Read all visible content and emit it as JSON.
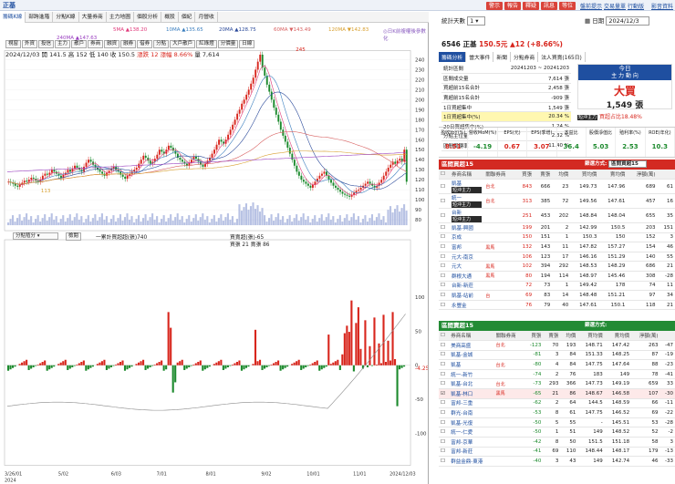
{
  "app": {
    "logo": "正基"
  },
  "top_buttons": [
    "警示",
    "報告",
    "釋疑",
    "訊息",
    "等位"
  ],
  "top_links": [
    "盤前提示",
    "交易量單",
    "行動版",
    "影音資料"
  ],
  "tabs": [
    "籌碼K線",
    "部跨進階",
    "分點K線",
    "大量券商",
    "主力地圖",
    "個股分析",
    "概股",
    "個紀",
    "月營收"
  ],
  "ma_legend": [
    {
      "label": "5MA ▲138.20",
      "color": "#e0397a"
    },
    {
      "label": "10MA ▲135.65",
      "color": "#3c7fbf"
    },
    {
      "label": "20MA ▲128.75",
      "color": "#2b4a9a"
    },
    {
      "label": "60MA ▼143.49",
      "color": "#d86060"
    },
    {
      "label": "120MA ▼142.83",
      "color": "#d8a030"
    },
    {
      "label": "240MA ▲147.63",
      "color": "#9a40c0"
    }
  ],
  "ma_note": "◎日K前複權後參數化",
  "chart_controls": [
    "視窗",
    "外資",
    "投信",
    "主力",
    "散戶",
    "券商",
    "融資",
    "融券",
    "借券",
    "分點",
    "大戶散戶",
    "紅綠燈",
    "分價量",
    "日線"
  ],
  "info": {
    "date": "2024/12/03",
    "price": "開 141.5 高 152 低 140 收 150.5",
    "change": "漲跌 12",
    "pct": "漲幅 8.66%",
    "vol": "量 7,614"
  },
  "price_axis": [
    "240",
    "230",
    "220",
    "210",
    "200",
    "190",
    "180",
    "170",
    "160",
    "150",
    "140",
    "130",
    "120",
    "110",
    "100",
    "90",
    "80"
  ],
  "price_axis_values": [
    240,
    230,
    220,
    210,
    200,
    190,
    180,
    170,
    160,
    150,
    140,
    130,
    120,
    110,
    100,
    90,
    80
  ],
  "peak_label": "245",
  "low_label": "113",
  "x_labels": [
    "3/26/01",
    "5/02",
    "6/03",
    "7/01",
    "8/01",
    "9/02",
    "10/01",
    "11/01",
    "2024/12/03"
  ],
  "sub_panel": {
    "select": "分點殖分",
    "button": "檢閱",
    "series1": "一累計買超超(張)740",
    "series2": "買賣超(張)-65",
    "series3": "買張 21 賣張 86",
    "axis": [
      "100",
      "50",
      "0",
      "-50",
      "-100"
    ],
    "axis_values": [
      100,
      50,
      0,
      -50,
      -100
    ],
    "last": "-4.25",
    "year": "2024"
  },
  "right_panel": {
    "stat_label": "統計天數",
    "stat_val": "1",
    "date_label": "日期",
    "date_val": "2024/12/3",
    "stock_title": "6546 正基",
    "stock_price": "150.5元",
    "stock_change": "▲12 (+8.66%)",
    "menu_tabs": [
      "籌碼分析",
      "當大事件",
      "新聞",
      "分點券商",
      "法人買賣(165日)"
    ],
    "summary": [
      [
        "統計區間",
        "20241203 ~ 20241203"
      ],
      [
        "區間成交量",
        "7,614 張"
      ],
      [
        "買超前15名合計",
        "2,458 張"
      ],
      [
        "賣超前15名合計",
        "-909 張"
      ],
      [
        "1日買超集中",
        "1,549 張"
      ],
      [
        "1日買超集中(%)",
        "20.34 %"
      ],
      [
        "20日買超集中(%)",
        "1.24 %"
      ],
      [
        "分點主位量",
        "2.32 %"
      ],
      [
        "區間周轉率",
        "11.40 %"
      ]
    ],
    "today_label": "今日",
    "main_label": "主 力 動 向",
    "big_buy": "大買",
    "big_amount": "1,549 張",
    "short_label": "短沖主力",
    "short_val": "買超占比18.48%",
    "metrics_labels": [
      "盈收YoY(%)",
      "營收MoM(%)",
      "EPS(元)",
      "EPS(季增)",
      "本益比",
      "股價淨值比",
      "殖利率(%)",
      "ROE(年化)"
    ],
    "metrics_vals": [
      "8.51",
      "-4.19",
      "0.67",
      "3.07",
      "36.4",
      "5.03",
      "2.53",
      "10.3"
    ],
    "buy_header": "區間買超15",
    "sell_header": "區間賣超15",
    "filter_label": "篩選方式:",
    "filter_val": "區間買超15",
    "col_headers": [
      "券商名稱",
      "關聯券商",
      "買張",
      "賣張",
      "均價",
      "買均價",
      "賣均價",
      "淨額(萬)"
    ],
    "buy_rows": [
      [
        "凱基",
        "短沖主力",
        "台北",
        "843",
        "666",
        "23",
        "149.73",
        "147.96",
        "689",
        "61"
      ],
      [
        "統一",
        "短沖主力",
        "台北",
        "313",
        "385",
        "72",
        "149.56",
        "147.61",
        "457",
        "16"
      ],
      [
        "台新",
        "短沖主力",
        "",
        "251",
        "453",
        "202",
        "148.84",
        "148.04",
        "655",
        "35"
      ],
      [
        "凱基-興國",
        "",
        "",
        "199",
        "201",
        "2",
        "142.99",
        "150.5",
        "203",
        "151"
      ],
      [
        "京成",
        "",
        "",
        "150",
        "151",
        "1",
        "150.3",
        "150",
        "152",
        "3"
      ],
      [
        "富邦",
        "",
        "黑馬",
        "132",
        "143",
        "11",
        "147.82",
        "157.27",
        "154",
        "46"
      ],
      [
        "元大-南京",
        "",
        "",
        "106",
        "123",
        "17",
        "146.16",
        "151.29",
        "140",
        "55"
      ],
      [
        "元大",
        "",
        "黑馬",
        "102",
        "394",
        "292",
        "148.53",
        "148.29",
        "686",
        "21"
      ],
      [
        "群根大通",
        "",
        "黑馬",
        "80",
        "194",
        "114",
        "148.97",
        "145.46",
        "308",
        "-28"
      ],
      [
        "台新-新莊",
        "",
        "",
        "72",
        "73",
        "1",
        "149.42",
        "178",
        "74",
        "11"
      ],
      [
        "凱基-站前",
        "",
        "台",
        "69",
        "83",
        "14",
        "148.48",
        "151.21",
        "97",
        "34"
      ],
      [
        "永豐金",
        "",
        "",
        "76",
        "79",
        "40",
        "147.61",
        "150.1",
        "118",
        "21"
      ]
    ],
    "sell_rows": [
      [
        "美商高盛",
        "台北",
        "",
        "-123",
        "70",
        "193",
        "148.71",
        "147.42",
        "263",
        "-47"
      ],
      [
        "凱基-金城",
        "",
        "",
        "-81",
        "3",
        "84",
        "151.33",
        "148.25",
        "87",
        "-19"
      ],
      [
        "凱基",
        "",
        "台北",
        "-80",
        "4",
        "84",
        "147.75",
        "147.64",
        "88",
        "-23"
      ],
      [
        "統一-新竹",
        "",
        "",
        "-74",
        "2",
        "76",
        "183",
        "149",
        "78",
        "-41"
      ],
      [
        "凱基-台北",
        "",
        "台北",
        "-73",
        "293",
        "366",
        "147.73",
        "149.19",
        "659",
        "33"
      ],
      [
        "凱基-林口",
        "",
        "黑馬",
        "-65",
        "21",
        "86",
        "148.67",
        "146.58",
        "107",
        "-30"
      ],
      [
        "富邦-三重",
        "",
        "",
        "-62",
        "2",
        "64",
        "144.5",
        "148.59",
        "66",
        "-11"
      ],
      [
        "群光-台南",
        "",
        "",
        "-53",
        "8",
        "61",
        "147.75",
        "146.52",
        "69",
        "-22"
      ],
      [
        "凱基-光復",
        "",
        "",
        "-50",
        "5",
        "55",
        "-",
        "145.51",
        "53",
        "-28"
      ],
      [
        "統一-仁愛",
        "",
        "",
        "-50",
        "1",
        "51",
        "149",
        "148.52",
        "52",
        "-2"
      ],
      [
        "富邦-京華",
        "",
        "",
        "-42",
        "8",
        "50",
        "151.5",
        "151.18",
        "58",
        "3"
      ],
      [
        "富邦-新莊",
        "",
        "",
        "-41",
        "69",
        "110",
        "148.44",
        "148.17",
        "179",
        "-13"
      ],
      [
        "群益金鼎-東港",
        "",
        "",
        "-40",
        "3",
        "43",
        "149",
        "142.74",
        "46",
        "-33"
      ]
    ]
  },
  "colors": {
    "up": "#d8261d",
    "down": "#1c8a2d",
    "accent": "#1f4fa0"
  }
}
